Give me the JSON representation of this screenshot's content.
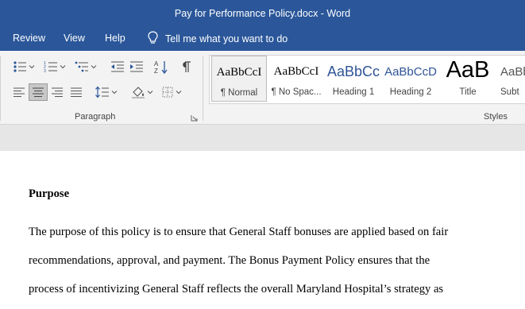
{
  "window": {
    "title": "Pay for Performance Policy.docx  -  Word"
  },
  "menu": {
    "items": [
      "Review",
      "View",
      "Help"
    ],
    "tell_me": "Tell me what you want to do"
  },
  "ribbon": {
    "paragraph_group_label": "Paragraph",
    "styles_group_label": "Styles",
    "styles": [
      {
        "preview": "AaBbCcI",
        "name": "¶ Normal",
        "selected": true
      },
      {
        "preview": "AaBbCcI",
        "name": "¶ No Spac..."
      },
      {
        "preview": "AaBbCc",
        "name": "Heading 1"
      },
      {
        "preview": "AaBbCcD",
        "name": "Heading 2"
      },
      {
        "preview": "AaB",
        "name": "Title"
      },
      {
        "preview": "AaBb",
        "name": "Subt"
      }
    ],
    "icons": [
      "bullets-icon",
      "numbering-icon",
      "multilevel-list-icon",
      "decrease-indent-icon",
      "increase-indent-icon",
      "sort-icon",
      "show-marks-icon",
      "align-left-icon",
      "align-center-icon",
      "align-right-icon",
      "justify-icon",
      "line-spacing-icon",
      "shading-icon",
      "borders-icon",
      "dialog-launcher-icon",
      "lightbulb-icon"
    ],
    "colors": {
      "accent": "#2b579a",
      "ribbon_bg": "#f3f3f3",
      "heading_blue": "#2f5496"
    }
  },
  "document": {
    "heading": "Purpose",
    "lines": [
      "The purpose of this policy is to ensure that General Staff bonuses are applied based on fair",
      "recommendations, approval, and payment. The Bonus Payment Policy ensures that the",
      "process of incentivizing General Staff reflects the overall Maryland Hospital’s strategy as"
    ]
  }
}
